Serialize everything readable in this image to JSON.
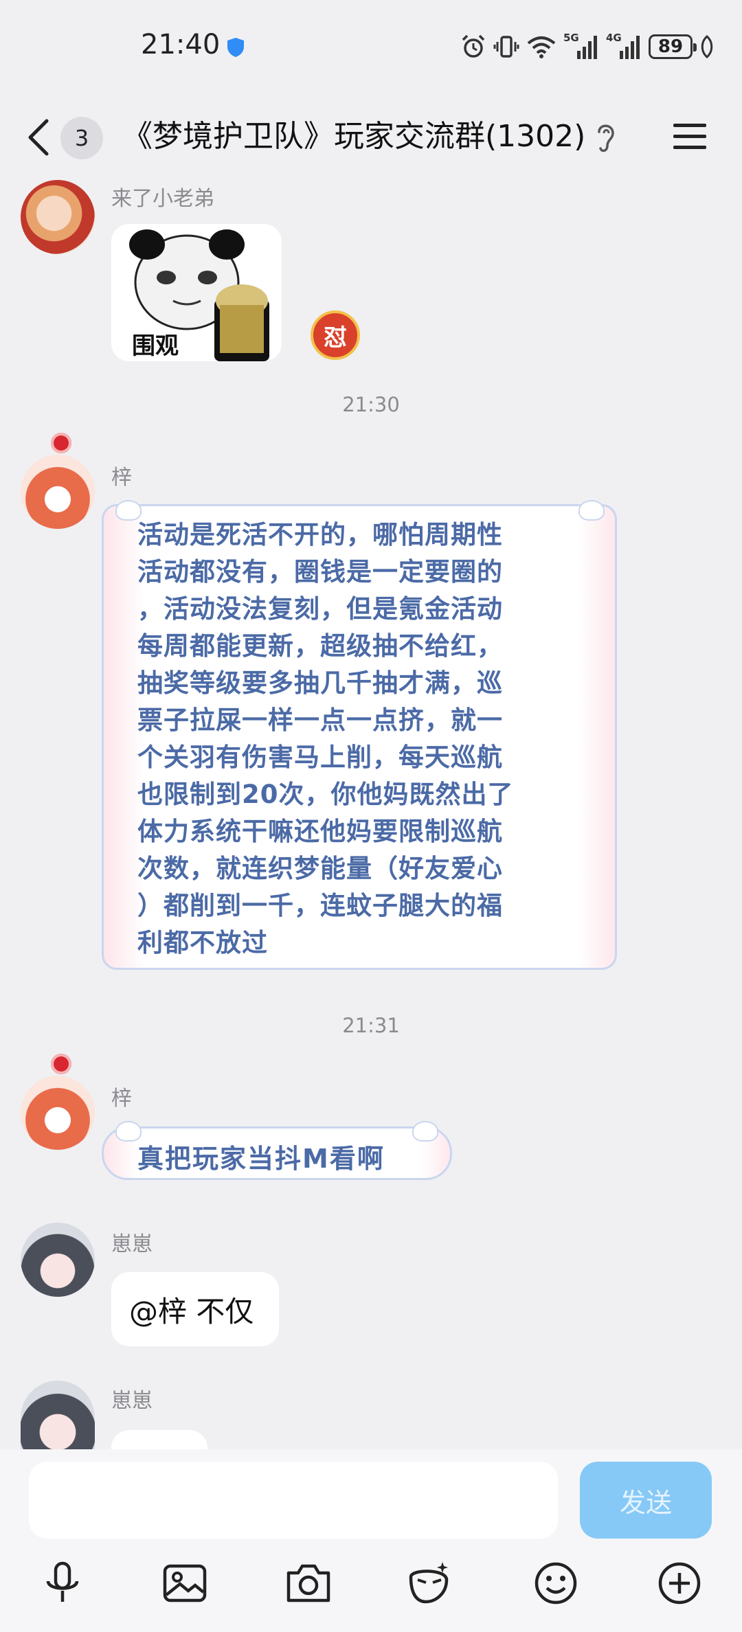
{
  "status": {
    "time": "21:40",
    "net1": "5G",
    "net2": "4G",
    "battery": "89"
  },
  "header": {
    "unread_count": "3",
    "title": "《梦境护卫队》玩家交流群(1302)"
  },
  "messages": [
    {
      "sender": "来了小老弟",
      "sticker_label": "围观",
      "badge_glyph": "怼"
    },
    {
      "timestamp": "21:30"
    },
    {
      "sender": "梓",
      "text": "活动是死活不开的，哪怕周期性\n活动都没有，圈钱是一定要圈的\n，活动没法复刻，但是氪金活动\n每周都能更新，超级抽不给红，\n抽奖等级要多抽几千抽才满，巡\n票子拉屎一样一点一点挤，就一\n个关羽有伤害马上削，每天巡航\n也限制到20次，你他妈既然出了\n体力系统干嘛还他妈要限制巡航\n次数，就连织梦能量（好友爱心\n）都削到一千，连蚊子腿大的福\n利都不放过"
    },
    {
      "timestamp": "21:31"
    },
    {
      "sender": "梓",
      "text": "真把玩家当抖M看啊"
    },
    {
      "sender": "崽崽",
      "text": "@梓 不仅"
    },
    {
      "sender": "崽崽"
    }
  ],
  "composer": {
    "send_label": "发送",
    "placeholder": ""
  },
  "toolbar": [
    "mic-icon",
    "image-icon",
    "camera-icon",
    "sticker-icon",
    "emoji-icon",
    "plus-icon"
  ],
  "colors": {
    "background": "#f0f0f3",
    "bubble_text": "#4b6aa6",
    "send_button": "#86c9f7",
    "verified": "#2f8df5"
  }
}
